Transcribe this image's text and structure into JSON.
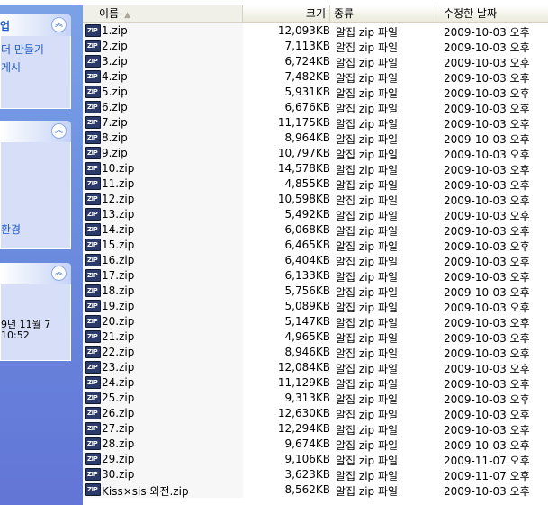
{
  "taskpane": {
    "groups": [
      {
        "title": "업",
        "links": [
          "더 만들기",
          "게시"
        ]
      },
      {
        "title": "",
        "links": [
          "환경"
        ]
      },
      {
        "title": "",
        "details": [
          "9년 11월 7",
          "10:52"
        ]
      }
    ],
    "collapse_glyph": "︽"
  },
  "columns": {
    "name": "이름",
    "size": "크기",
    "type": "종류",
    "modified": "수정한 날짜"
  },
  "icon_label": "ZIP",
  "files": [
    {
      "name": "1.zip",
      "size": "12,093KB",
      "type": "알집 zip 파일",
      "modified": "2009-10-03 오후"
    },
    {
      "name": "2.zip",
      "size": "7,113KB",
      "type": "알집 zip 파일",
      "modified": "2009-10-03 오후"
    },
    {
      "name": "3.zip",
      "size": "6,724KB",
      "type": "알집 zip 파일",
      "modified": "2009-10-03 오후"
    },
    {
      "name": "4.zip",
      "size": "7,482KB",
      "type": "알집 zip 파일",
      "modified": "2009-10-03 오후"
    },
    {
      "name": "5.zip",
      "size": "5,931KB",
      "type": "알집 zip 파일",
      "modified": "2009-10-03 오후"
    },
    {
      "name": "6.zip",
      "size": "6,676KB",
      "type": "알집 zip 파일",
      "modified": "2009-10-03 오후"
    },
    {
      "name": "7.zip",
      "size": "11,175KB",
      "type": "알집 zip 파일",
      "modified": "2009-10-03 오후"
    },
    {
      "name": "8.zip",
      "size": "8,964KB",
      "type": "알집 zip 파일",
      "modified": "2009-10-03 오후"
    },
    {
      "name": "9.zip",
      "size": "10,797KB",
      "type": "알집 zip 파일",
      "modified": "2009-10-03 오후"
    },
    {
      "name": "10.zip",
      "size": "14,578KB",
      "type": "알집 zip 파일",
      "modified": "2009-10-03 오후"
    },
    {
      "name": "11.zip",
      "size": "4,855KB",
      "type": "알집 zip 파일",
      "modified": "2009-10-03 오후"
    },
    {
      "name": "12.zip",
      "size": "10,598KB",
      "type": "알집 zip 파일",
      "modified": "2009-10-03 오후"
    },
    {
      "name": "13.zip",
      "size": "5,492KB",
      "type": "알집 zip 파일",
      "modified": "2009-10-03 오후"
    },
    {
      "name": "14.zip",
      "size": "6,068KB",
      "type": "알집 zip 파일",
      "modified": "2009-10-03 오후"
    },
    {
      "name": "15.zip",
      "size": "6,465KB",
      "type": "알집 zip 파일",
      "modified": "2009-10-03 오후"
    },
    {
      "name": "16.zip",
      "size": "6,404KB",
      "type": "알집 zip 파일",
      "modified": "2009-10-03 오후"
    },
    {
      "name": "17.zip",
      "size": "6,133KB",
      "type": "알집 zip 파일",
      "modified": "2009-10-03 오후"
    },
    {
      "name": "18.zip",
      "size": "5,756KB",
      "type": "알집 zip 파일",
      "modified": "2009-10-03 오후"
    },
    {
      "name": "19.zip",
      "size": "5,089KB",
      "type": "알집 zip 파일",
      "modified": "2009-10-03 오후"
    },
    {
      "name": "20.zip",
      "size": "5,147KB",
      "type": "알집 zip 파일",
      "modified": "2009-10-03 오후"
    },
    {
      "name": "21.zip",
      "size": "4,965KB",
      "type": "알집 zip 파일",
      "modified": "2009-10-03 오후"
    },
    {
      "name": "22.zip",
      "size": "8,946KB",
      "type": "알집 zip 파일",
      "modified": "2009-10-03 오후"
    },
    {
      "name": "23.zip",
      "size": "12,084KB",
      "type": "알집 zip 파일",
      "modified": "2009-10-03 오후"
    },
    {
      "name": "24.zip",
      "size": "11,129KB",
      "type": "알집 zip 파일",
      "modified": "2009-10-03 오후"
    },
    {
      "name": "25.zip",
      "size": "9,313KB",
      "type": "알집 zip 파일",
      "modified": "2009-10-03 오후"
    },
    {
      "name": "26.zip",
      "size": "12,630KB",
      "type": "알집 zip 파일",
      "modified": "2009-10-03 오후"
    },
    {
      "name": "27.zip",
      "size": "12,294KB",
      "type": "알집 zip 파일",
      "modified": "2009-10-03 오후"
    },
    {
      "name": "28.zip",
      "size": "9,674KB",
      "type": "알집 zip 파일",
      "modified": "2009-10-03 오후"
    },
    {
      "name": "29.zip",
      "size": "9,106KB",
      "type": "알집 zip 파일",
      "modified": "2009-11-07 오후"
    },
    {
      "name": "30.zip",
      "size": "3,623KB",
      "type": "알집 zip 파일",
      "modified": "2009-11-07 오후"
    },
    {
      "name": "Kiss×sis 외전.zip",
      "size": "8,562KB",
      "type": "알집 zip 파일",
      "modified": "2009-10-03 오후"
    }
  ]
}
